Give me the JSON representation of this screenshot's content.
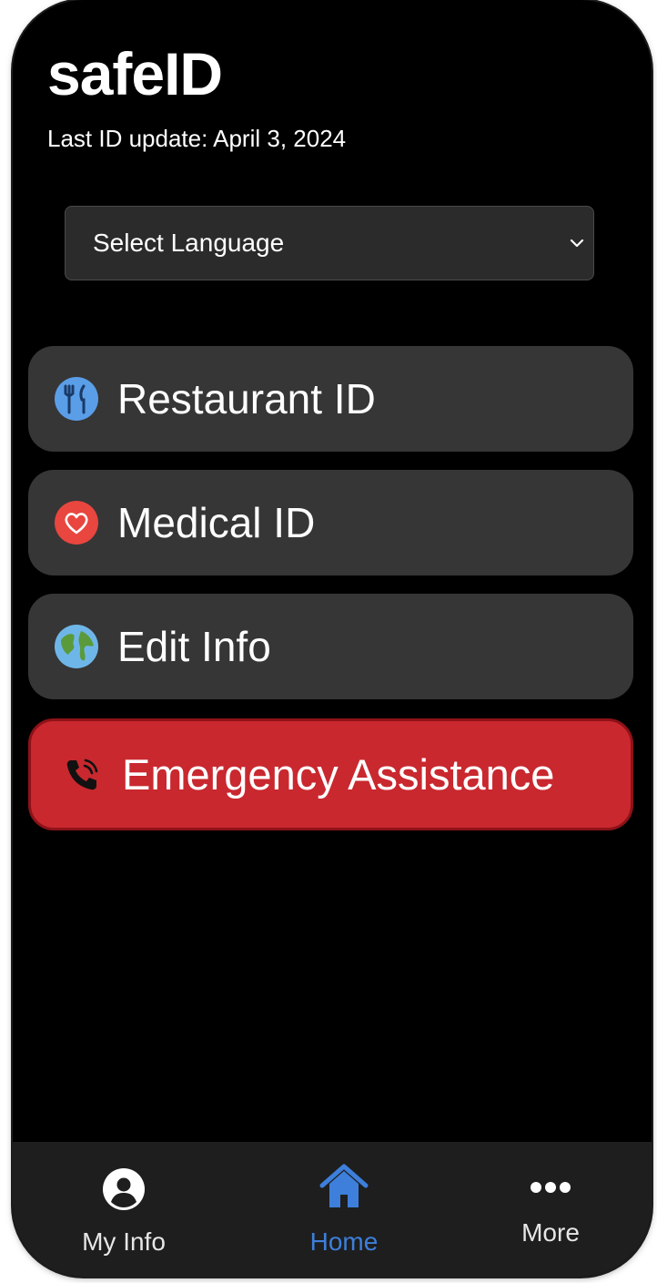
{
  "app": {
    "title": "safeID",
    "last_update": "Last ID update: April 3, 2024"
  },
  "language_select": {
    "selected": "Select Language"
  },
  "menu": [
    {
      "label": "Restaurant ID",
      "icon": "fork-knife-icon"
    },
    {
      "label": "Medical ID",
      "icon": "heart-icon"
    },
    {
      "label": "Edit Info",
      "icon": "globe-icon"
    }
  ],
  "emergency": {
    "label": "Emergency Assistance",
    "icon": "phone-ringing-icon",
    "color": "#c9282f"
  },
  "tabbar": {
    "active": "Home",
    "accent_color": "#3d7fdb",
    "tabs": [
      {
        "label": "My Info",
        "icon": "user-circle-icon"
      },
      {
        "label": "Home",
        "icon": "home-icon"
      },
      {
        "label": "More",
        "icon": "more-dots-icon"
      }
    ]
  }
}
